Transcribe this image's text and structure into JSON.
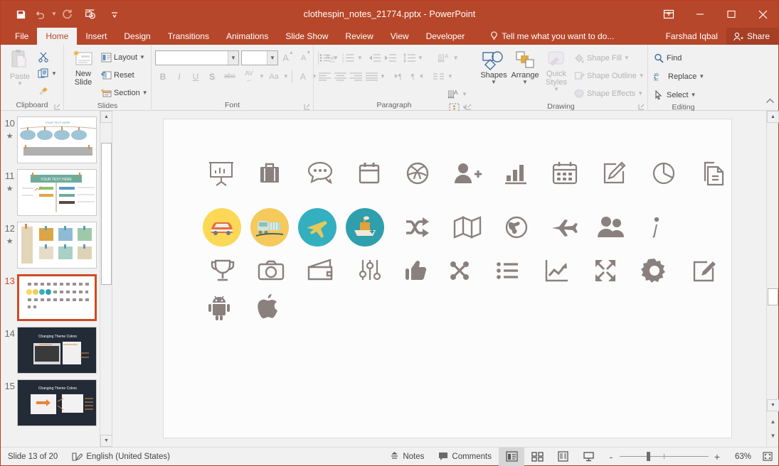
{
  "app": {
    "title": "clothespin_notes_21774.pptx - PowerPoint",
    "accent": "#b7472a",
    "share_bg": "#a53f25"
  },
  "quick_access": [
    {
      "name": "save-icon",
      "label": "Save"
    },
    {
      "name": "undo-icon",
      "label": "Undo"
    },
    {
      "name": "redo-icon",
      "label": "Redo"
    },
    {
      "name": "start-presentation-icon",
      "label": "Start From Beginning"
    },
    {
      "name": "customize-qat-icon",
      "label": "Customize Quick Access Toolbar"
    }
  ],
  "window_controls": [
    {
      "name": "ribbon-display-options-icon",
      "label": "Ribbon Display Options"
    },
    {
      "name": "minimize-icon",
      "label": "Minimize"
    },
    {
      "name": "maximize-icon",
      "label": "Restore Down"
    },
    {
      "name": "close-icon",
      "label": "Close"
    }
  ],
  "tabs": [
    {
      "label": "File",
      "active": false,
      "file": true
    },
    {
      "label": "Home",
      "active": true
    },
    {
      "label": "Insert",
      "active": false
    },
    {
      "label": "Design",
      "active": false
    },
    {
      "label": "Transitions",
      "active": false
    },
    {
      "label": "Animations",
      "active": false
    },
    {
      "label": "Slide Show",
      "active": false
    },
    {
      "label": "Review",
      "active": false
    },
    {
      "label": "View",
      "active": false
    },
    {
      "label": "Developer",
      "active": false
    }
  ],
  "tellme": {
    "label": "Tell me what you want to do...",
    "icon": "lightbulb-icon"
  },
  "account": {
    "user": "Farshad Iqbal",
    "share_label": "Share",
    "share_icon": "share-person-icon"
  },
  "ribbon": {
    "groups": [
      {
        "label": "Clipboard",
        "dialog_launcher": true
      },
      {
        "label": "Slides",
        "dialog_launcher": false
      },
      {
        "label": "Font",
        "dialog_launcher": true
      },
      {
        "label": "Paragraph",
        "dialog_launcher": true
      },
      {
        "label": "Drawing",
        "dialog_launcher": true
      },
      {
        "label": "Editing",
        "dialog_launcher": false
      }
    ],
    "clipboard": {
      "paste": "Paste",
      "cut_icon": "scissors-icon",
      "copy_icon": "copy-icon",
      "format_painter_icon": "format-painter-icon"
    },
    "slides": {
      "new_slide": "New Slide",
      "layout": "Layout",
      "reset": "Reset",
      "section": "Section"
    },
    "font": {
      "font_name": "",
      "font_name_placeholder": "",
      "font_size": "",
      "increase_size": "A",
      "decrease_size": "A",
      "clear_formatting_icon": "clear-formatting-icon",
      "bold": "B",
      "italic": "I",
      "underline": "U",
      "shadow": "S",
      "strikethrough": "abc",
      "character_spacing": "AV",
      "change_case": "Aa",
      "font_color": "A"
    },
    "paragraph": {
      "bullets_icon": "bullets-icon",
      "numbering_icon": "numbering-icon",
      "decrease_indent_icon": "decrease-indent-icon",
      "increase_indent_icon": "increase-indent-icon",
      "line_spacing_icon": "line-spacing-icon",
      "text_direction_icon": "text-direction-icon",
      "align_text_icon": "align-text-icon",
      "convert_smartart_icon": "convert-to-smartart-icon",
      "align_left_icon": "align-left-icon",
      "center_icon": "align-center-icon",
      "align_right_icon": "align-right-icon",
      "justify_icon": "justify-icon",
      "columns_icon": "columns-icon",
      "ltr_icon": "left-to-right-icon",
      "rtl_icon": "right-to-left-icon"
    },
    "drawing": {
      "shapes": "Shapes",
      "arrange": "Arrange",
      "quick_styles": "Quick Styles",
      "shape_fill": "Shape Fill",
      "shape_outline": "Shape Outline",
      "shape_effects": "Shape Effects"
    },
    "editing": {
      "find": "Find",
      "replace": "Replace",
      "select": "Select",
      "collapse_ribbon_icon": "collapse-ribbon-icon"
    }
  },
  "thumbnails": [
    {
      "number": "10",
      "animated": true,
      "selected": false,
      "style": "clothespin-banner"
    },
    {
      "number": "11",
      "animated": true,
      "selected": false,
      "style": "clothespin-timeline"
    },
    {
      "number": "12",
      "animated": true,
      "selected": false,
      "style": "sticky-notes"
    },
    {
      "number": "13",
      "animated": false,
      "selected": true,
      "style": "icon-grid"
    },
    {
      "number": "14",
      "animated": false,
      "selected": false,
      "style": "dark-theme",
      "caption": "Changing Theme Colors"
    },
    {
      "number": "15",
      "animated": false,
      "selected": false,
      "style": "dark-theme",
      "caption": "Changing Theme Colors"
    }
  ],
  "slide": {
    "rows": [
      {
        "id": "row-1",
        "icons": [
          {
            "name": "presentation-board-icon",
            "glyph": "board"
          },
          {
            "name": "briefcase-icon",
            "glyph": "briefcase"
          },
          {
            "name": "chat-bubbles-icon",
            "glyph": "chat"
          },
          {
            "name": "calendar-icon",
            "glyph": "calendar"
          },
          {
            "name": "ball-icon",
            "glyph": "ball"
          },
          {
            "name": "add-person-icon",
            "glyph": "addperson"
          },
          {
            "name": "bar-chart-icon",
            "glyph": "barchart"
          },
          {
            "name": "calendar-grid-icon",
            "glyph": "calgrid"
          },
          {
            "name": "edit-pencil-icon",
            "glyph": "editpencil"
          },
          {
            "name": "pie-chart-icon",
            "glyph": "pie"
          },
          {
            "name": "documents-icon",
            "glyph": "docs"
          }
        ]
      },
      {
        "id": "row-2",
        "icons": [
          {
            "name": "car-circle-icon",
            "glyph": "car",
            "circle_bg": "#fcd856"
          },
          {
            "name": "train-circle-icon",
            "glyph": "train",
            "circle_bg": "#f5c95c"
          },
          {
            "name": "airplane-circle-icon",
            "glyph": "plane",
            "circle_bg": "#34afc0"
          },
          {
            "name": "ship-circle-icon",
            "glyph": "ship",
            "circle_bg": "#2f9fae"
          },
          {
            "name": "shuffle-icon",
            "glyph": "shuffle"
          },
          {
            "name": "map-icon",
            "glyph": "map"
          },
          {
            "name": "globe-icon",
            "glyph": "globe"
          },
          {
            "name": "plane-departure-icon",
            "glyph": "planedep"
          },
          {
            "name": "people-group-icon",
            "glyph": "people"
          },
          {
            "name": "info-icon",
            "glyph": "info"
          }
        ]
      },
      {
        "id": "row-3",
        "icons": [
          {
            "name": "trophy-icon",
            "glyph": "trophy"
          },
          {
            "name": "camera-icon",
            "glyph": "camera"
          },
          {
            "name": "wallet-icon",
            "glyph": "wallet"
          },
          {
            "name": "sliders-icon",
            "glyph": "sliders"
          },
          {
            "name": "thumbs-up-icon",
            "glyph": "thumbsup"
          },
          {
            "name": "joomla-icon",
            "glyph": "joomla"
          },
          {
            "name": "list-icon",
            "glyph": "list"
          },
          {
            "name": "line-chart-icon",
            "glyph": "linechart"
          },
          {
            "name": "expand-arrows-icon",
            "glyph": "expand"
          },
          {
            "name": "gear-icon",
            "glyph": "gear"
          },
          {
            "name": "edit-square-icon",
            "glyph": "editsquare"
          }
        ]
      },
      {
        "id": "row-4",
        "icons": [
          {
            "name": "android-icon",
            "glyph": "android"
          },
          {
            "name": "apple-icon",
            "glyph": "apple"
          }
        ]
      }
    ]
  },
  "status": {
    "slide_counter": "Slide 13 of 20",
    "language_icon": "proofing-icon",
    "language": "English (United States)",
    "notes": "Notes",
    "notes_icon": "notes-icon",
    "comments": "Comments",
    "comments_icon": "comments-icon",
    "views": [
      {
        "name": "normal-view-button",
        "label": "Normal",
        "active": true
      },
      {
        "name": "slide-sorter-view-button",
        "label": "Slide Sorter",
        "active": false
      },
      {
        "name": "reading-view-button",
        "label": "Reading View",
        "active": false
      },
      {
        "name": "slide-show-button",
        "label": "Slide Show",
        "active": false
      }
    ],
    "zoom_out": "-",
    "zoom_in": "+",
    "zoom_level": "63%",
    "fit_slide_icon": "fit-to-window-icon"
  }
}
